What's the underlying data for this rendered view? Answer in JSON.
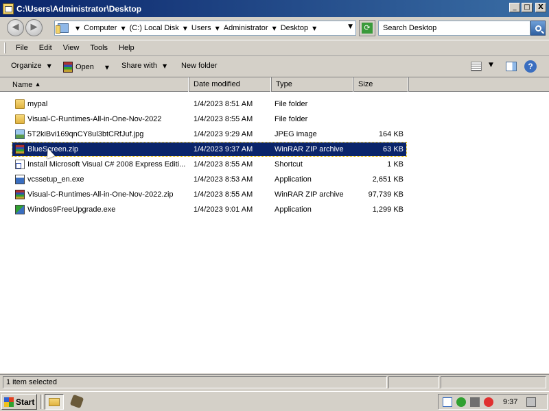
{
  "window": {
    "title": "C:\\Users\\Administrator\\Desktop",
    "minimize": "_",
    "maximize": "□",
    "close": "X"
  },
  "address": {
    "crumbs": [
      "Computer",
      "(C:) Local Disk",
      "Users",
      "Administrator",
      "Desktop"
    ],
    "search_placeholder": "Search Desktop"
  },
  "menu": {
    "items": [
      "File",
      "Edit",
      "View",
      "Tools",
      "Help"
    ]
  },
  "toolbar": {
    "organize": "Organize",
    "open": "Open",
    "share_with": "Share with",
    "new_folder": "New folder"
  },
  "columns": {
    "name": "Name",
    "date_modified": "Date modified",
    "type": "Type",
    "size": "Size"
  },
  "files": [
    {
      "name": "mypal",
      "date": "1/4/2023 8:51 AM",
      "type": "File folder",
      "size": "",
      "icon": "folder-icon"
    },
    {
      "name": "Visual-C-Runtimes-All-in-One-Nov-2022",
      "date": "1/4/2023 8:55 AM",
      "type": "File folder",
      "size": "",
      "icon": "folder-icon"
    },
    {
      "name": "5T2kiBvi169qnCY8ul3btCRfJuf.jpg",
      "date": "1/4/2023 9:29 AM",
      "type": "JPEG image",
      "size": "164 KB",
      "icon": "jpeg-image-icon"
    },
    {
      "name": "BlueScreen.zip",
      "date": "1/4/2023 9:37 AM",
      "type": "WinRAR ZIP archive",
      "size": "63 KB",
      "icon": "winrar-zip-icon",
      "selected": true
    },
    {
      "name": "Install Microsoft Visual C# 2008 Express Editi...",
      "date": "1/4/2023 8:55 AM",
      "type": "Shortcut",
      "size": "1 KB",
      "icon": "shortcut-icon"
    },
    {
      "name": "vcssetup_en.exe",
      "date": "1/4/2023 8:53 AM",
      "type": "Application",
      "size": "2,651 KB",
      "icon": "setup-exe-icon"
    },
    {
      "name": "Visual-C-Runtimes-All-in-One-Nov-2022.zip",
      "date": "1/4/2023 8:55 AM",
      "type": "WinRAR ZIP archive",
      "size": "97,739 KB",
      "icon": "winrar-zip-icon"
    },
    {
      "name": "Windos9FreeUpgrade.exe",
      "date": "1/4/2023 9:01 AM",
      "type": "Application",
      "size": "1,299 KB",
      "icon": "exe-icon"
    }
  ],
  "status": {
    "selection": "1 item selected"
  },
  "taskbar": {
    "start_label": "Start",
    "clock": "9:37"
  }
}
